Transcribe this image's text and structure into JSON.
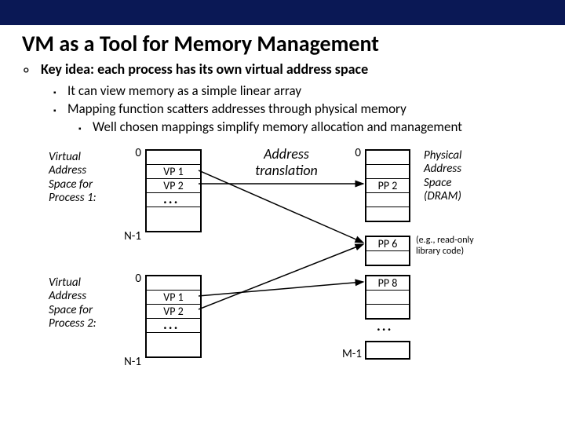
{
  "title": "VM as a Tool for Memory Management",
  "bullets": {
    "l1": "Key idea: each process has its own virtual address space",
    "l2a": "It can view memory as a simple linear array",
    "l2b": "Mapping function scatters addresses through physical memory",
    "l3a": "Well chosen mappings simplify memory allocation and management"
  },
  "vas1": {
    "label": "Virtual\nAddress\nSpace for\nProcess 1:",
    "idx_top": "0",
    "idx_bot": "N-1",
    "rows": {
      "vp1": "VP 1",
      "vp2": "VP 2"
    }
  },
  "vas2": {
    "label": "Virtual\nAddress\nSpace for\nProcess 2:",
    "idx_top": "0",
    "idx_bot": "N-1",
    "rows": {
      "vp1": "VP 1",
      "vp2": "VP 2"
    }
  },
  "trans": "Address\ntranslation",
  "phys": {
    "idx_top": "0",
    "idx_bot": "M-1",
    "label": "Physical\nAddress\nSpace\n(DRAM)",
    "ro": "(e.g., read-only\nlibrary code)",
    "pp2": "PP 2",
    "pp6": "PP 6",
    "pp8": "PP 8"
  },
  "dots": "..."
}
